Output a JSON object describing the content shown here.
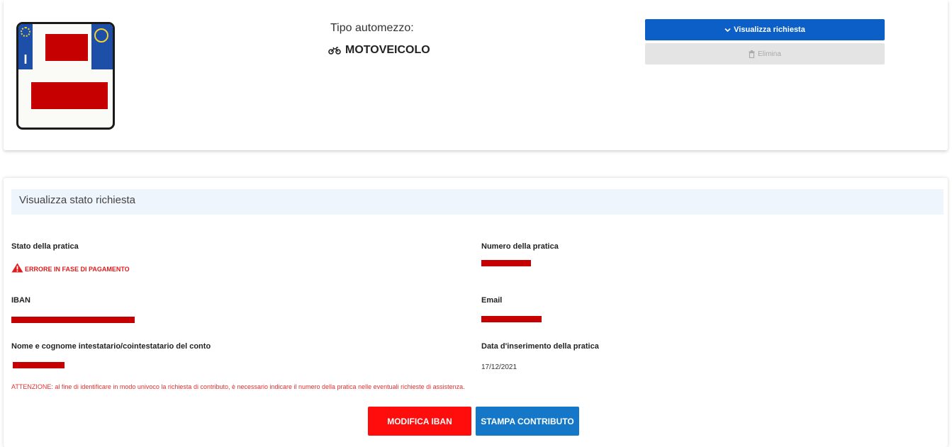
{
  "vehicle": {
    "type_label": "Tipo automezzo:",
    "type_value": "MOTOVEICOLO",
    "type_icon": "motorcycle-icon",
    "plate_country": "I"
  },
  "actions": {
    "view_request_label": "Visualizza richiesta",
    "view_request_icon": "chevron-down-icon",
    "delete_label": "Elimina",
    "delete_icon": "trash-icon"
  },
  "status_section": {
    "title": "Visualizza stato richiesta",
    "fields": {
      "stato_label": "Stato della pratica",
      "stato_value": "ERRORE IN FASE DI PAGAMENTO",
      "stato_icon": "warning-icon",
      "numero_label": "Numero della pratica",
      "iban_label": "IBAN",
      "email_label": "Email",
      "nome_label": "Nome e cognome intestatario/cointestatario del conto",
      "data_label": "Data d'inserimento della pratica",
      "data_value": "17/12/2021"
    },
    "attention": "ATTENZIONE: al fine di identificare in modo univoco la richiesta di contributo, è necessario indicare il numero della pratica nelle eventuali richieste di assistenza.",
    "modify_iban_label": "MODIFICA IBAN",
    "print_label": "STAMPA CONTRIBUTO"
  },
  "colors": {
    "primary_blue": "#0b5fc7",
    "error_red": "#e01b1b",
    "modify_red": "#ff0d0d",
    "print_blue": "#1477c7",
    "redaction": "#c60000"
  }
}
